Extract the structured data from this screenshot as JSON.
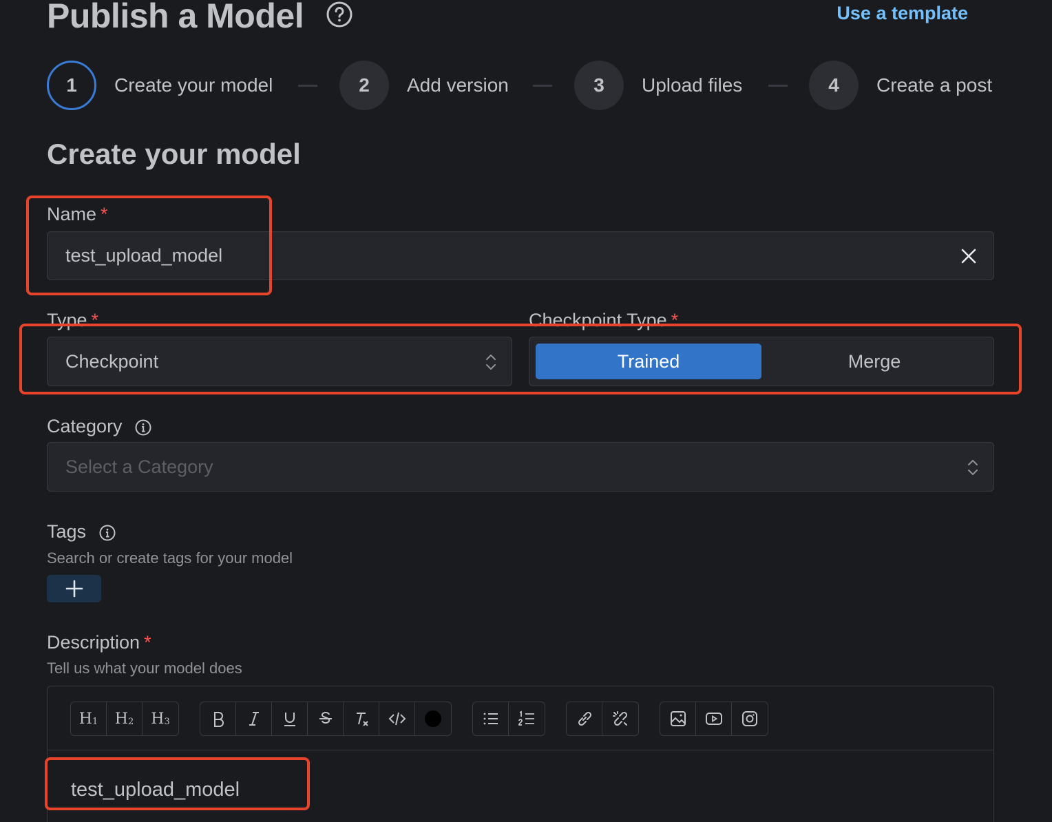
{
  "header": {
    "title": "Publish a Model",
    "template_link": "Use a template"
  },
  "stepper": {
    "steps": [
      {
        "number": "1",
        "label": "Create your model",
        "active": true
      },
      {
        "number": "2",
        "label": "Add version",
        "active": false
      },
      {
        "number": "3",
        "label": "Upload files",
        "active": false
      },
      {
        "number": "4",
        "label": "Create a post",
        "active": false
      }
    ]
  },
  "form": {
    "section_title": "Create your model",
    "name": {
      "label": "Name",
      "required_mark": "*",
      "value": "test_upload_model"
    },
    "type": {
      "label": "Type",
      "required_mark": "*",
      "value": "Checkpoint"
    },
    "checkpoint_type": {
      "label": "Checkpoint Type",
      "required_mark": "*",
      "options": [
        "Trained",
        "Merge"
      ],
      "selected": "Trained"
    },
    "category": {
      "label": "Category",
      "placeholder": "Select a Category"
    },
    "tags": {
      "label": "Tags",
      "hint": "Search or create tags for your model",
      "add_symbol": "+"
    },
    "description": {
      "label": "Description",
      "required_mark": "*",
      "hint": "Tell us what your model does",
      "content": "test_upload_model",
      "toolbar": {
        "headings": [
          "H1",
          "H2",
          "H3"
        ],
        "formatting": [
          "bold-icon",
          "italic-icon",
          "underline-icon",
          "strikethrough-icon",
          "clear-format-icon",
          "code-icon",
          "color-swatch"
        ],
        "lists": [
          "bullet-list-icon",
          "ordered-list-icon"
        ],
        "links": [
          "link-icon",
          "unlink-icon"
        ],
        "media": [
          "image-icon",
          "youtube-icon",
          "instagram-icon"
        ]
      }
    }
  },
  "colors": {
    "background": "#1a1b1e",
    "accent": "#3275c8",
    "link": "#74c0fc",
    "required": "#fa5252",
    "annotation": "#e8432b"
  }
}
